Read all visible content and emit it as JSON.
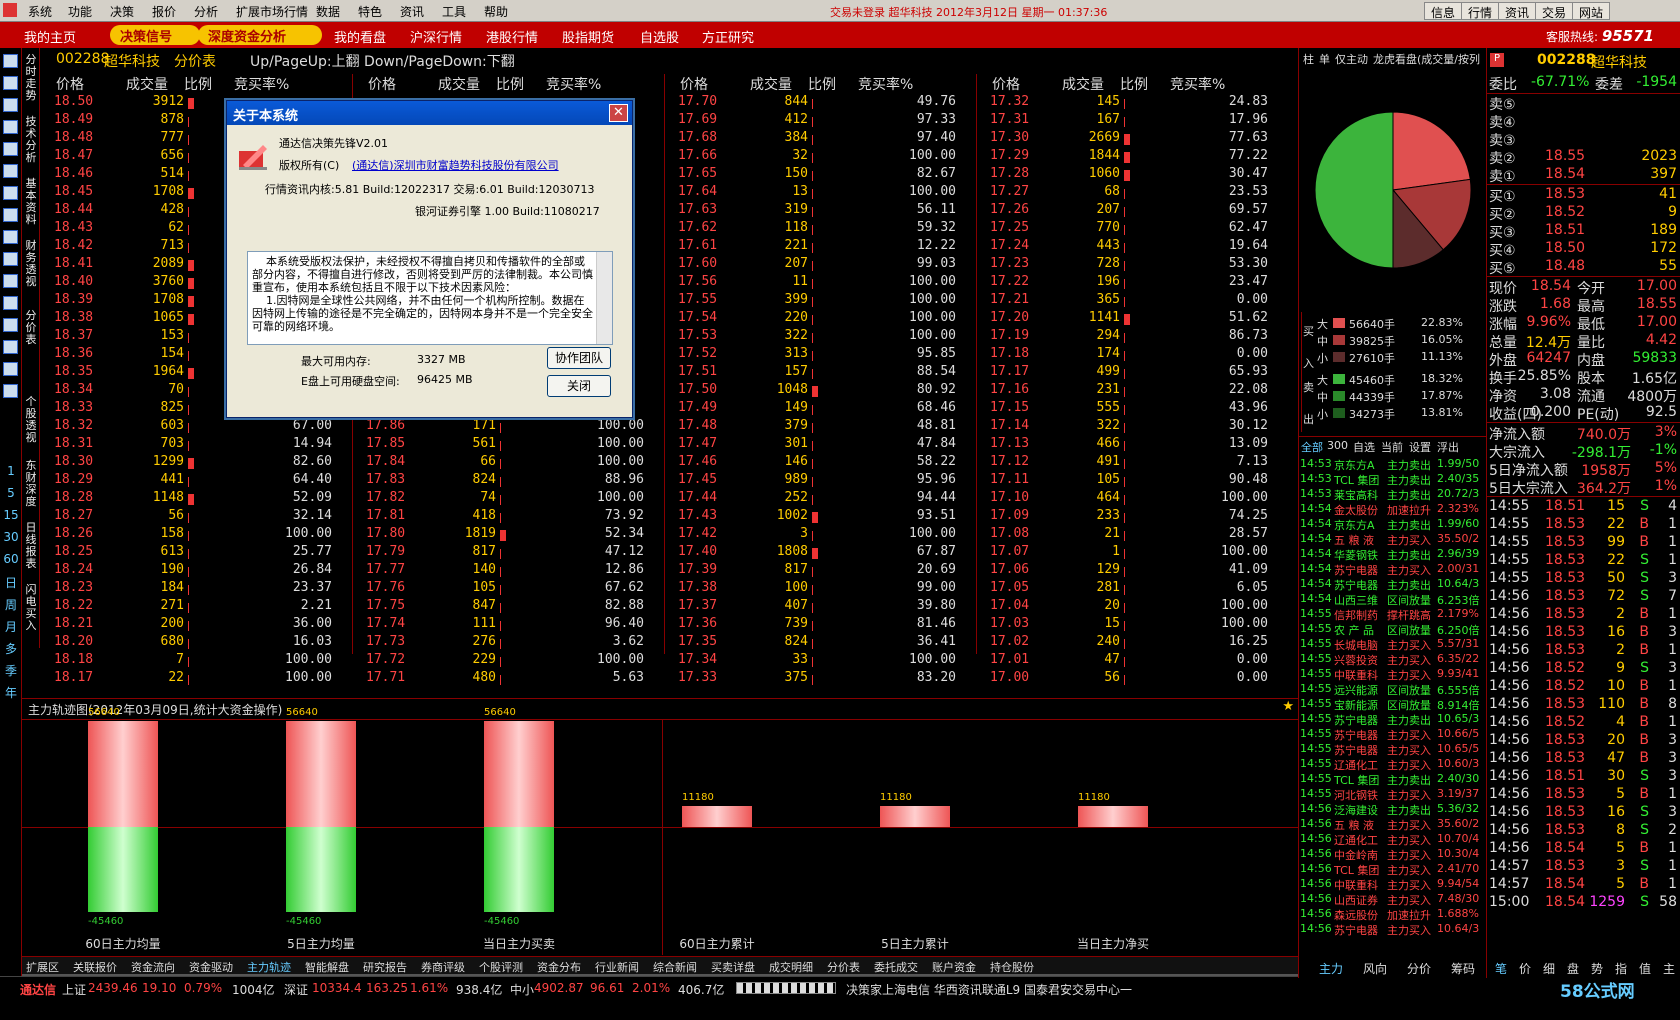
{
  "menu": {
    "items": [
      "系统",
      "功能",
      "决策",
      "报价",
      "分析",
      "扩展市场行情",
      "数据",
      "特色",
      "资讯",
      "工具",
      "帮助"
    ],
    "status": "交易未登录  超华科技  2012年3月12日  星期一  01:37:36",
    "right": [
      "信息",
      "行情",
      "资讯",
      "交易",
      "网站"
    ]
  },
  "nav": {
    "items": [
      "我的主页",
      "决策信号",
      "深度资金分析",
      "我的看盘",
      "沪深行情",
      "港股行情",
      "股指期货",
      "自选股",
      "方正研究"
    ],
    "hotline_label": "客服热线:",
    "hotline_num": "95571"
  },
  "leftbar": {
    "vtext": [
      "分时走势",
      "技术分析",
      "基本资料",
      "财务透视",
      "分价表",
      "个股透视",
      "东财深度",
      "日线报表",
      "闪电买入"
    ],
    "periods": [
      "1",
      "5",
      "15",
      "30",
      "60",
      "日",
      "周",
      "月",
      "多",
      "季",
      "年"
    ]
  },
  "header": {
    "code": "002288",
    "name": "超华科技",
    "view": "分价表",
    "hint": "Up/PageUp:上翻 Down/PageDown:下翻"
  },
  "cols": {
    "price": "价格",
    "volume": "成交量",
    "ratio": "比例",
    "bidrate": "竞买率%"
  },
  "table": {
    "c1": [
      [
        "18.50",
        "3912",
        ""
      ],
      [
        "18.49",
        "878",
        ""
      ],
      [
        "18.48",
        "777",
        ""
      ],
      [
        "18.47",
        "656",
        ""
      ],
      [
        "18.46",
        "514",
        ""
      ],
      [
        "18.45",
        "1708",
        ""
      ],
      [
        "18.44",
        "428",
        ""
      ],
      [
        "18.43",
        "62",
        ""
      ],
      [
        "18.42",
        "713",
        ""
      ],
      [
        "18.41",
        "2089",
        ""
      ],
      [
        "18.40",
        "3760",
        ""
      ],
      [
        "18.39",
        "1708",
        ""
      ],
      [
        "18.38",
        "1065",
        ""
      ],
      [
        "18.37",
        "153",
        ""
      ],
      [
        "18.36",
        "154",
        ""
      ],
      [
        "18.35",
        "1964",
        ""
      ],
      [
        "18.34",
        "70",
        ""
      ],
      [
        "18.33",
        "825",
        ""
      ],
      [
        "18.32",
        "603",
        "67.00"
      ],
      [
        "18.31",
        "703",
        "14.94"
      ],
      [
        "18.30",
        "1299",
        "82.60"
      ],
      [
        "18.29",
        "441",
        "64.40"
      ],
      [
        "18.28",
        "1148",
        "52.09"
      ],
      [
        "18.27",
        "56",
        "32.14"
      ],
      [
        "18.26",
        "158",
        "100.00"
      ],
      [
        "18.25",
        "613",
        "25.77"
      ],
      [
        "18.24",
        "190",
        "26.84"
      ],
      [
        "18.23",
        "184",
        "23.37"
      ],
      [
        "18.22",
        "271",
        "2.21"
      ],
      [
        "18.21",
        "200",
        "36.00"
      ],
      [
        "18.20",
        "680",
        "16.03"
      ],
      [
        "18.18",
        "7",
        "100.00"
      ],
      [
        "18.17",
        "22",
        "100.00"
      ]
    ],
    "c2": [
      [
        "",
        "",
        ""
      ],
      [
        "",
        "",
        ""
      ],
      [
        "",
        "",
        ""
      ],
      [
        "",
        "",
        ""
      ],
      [
        "",
        "",
        ""
      ],
      [
        "",
        "",
        ""
      ],
      [
        "",
        "",
        ""
      ],
      [
        "",
        "",
        ""
      ],
      [
        "",
        "",
        ""
      ],
      [
        "",
        "",
        ""
      ],
      [
        "",
        "",
        ""
      ],
      [
        "",
        "",
        ""
      ],
      [
        "",
        "",
        ""
      ],
      [
        "",
        "",
        ""
      ],
      [
        "",
        "",
        ""
      ],
      [
        "",
        "",
        ""
      ],
      [
        "",
        "",
        ""
      ],
      [
        "",
        "",
        ""
      ],
      [
        "17.86",
        "171",
        "100.00"
      ],
      [
        "17.85",
        "561",
        "100.00"
      ],
      [
        "17.84",
        "66",
        "100.00"
      ],
      [
        "17.83",
        "824",
        "88.96"
      ],
      [
        "17.82",
        "74",
        "100.00"
      ],
      [
        "17.81",
        "418",
        "73.92"
      ],
      [
        "17.80",
        "1819",
        "52.34"
      ],
      [
        "17.79",
        "817",
        "47.12"
      ],
      [
        "17.77",
        "140",
        "12.86"
      ],
      [
        "17.76",
        "105",
        "67.62"
      ],
      [
        "17.75",
        "847",
        "82.88"
      ],
      [
        "17.74",
        "111",
        "96.40"
      ],
      [
        "17.73",
        "276",
        "3.62"
      ],
      [
        "17.72",
        "229",
        "100.00"
      ],
      [
        "17.71",
        "480",
        "5.63"
      ]
    ],
    "c3": [
      [
        "17.70",
        "844",
        "49.76"
      ],
      [
        "17.69",
        "412",
        "97.33"
      ],
      [
        "17.68",
        "384",
        "97.40"
      ],
      [
        "17.66",
        "32",
        "100.00"
      ],
      [
        "17.65",
        "150",
        "82.67"
      ],
      [
        "17.64",
        "13",
        "100.00"
      ],
      [
        "17.63",
        "319",
        "56.11"
      ],
      [
        "17.62",
        "118",
        "59.32"
      ],
      [
        "17.61",
        "221",
        "12.22"
      ],
      [
        "17.60",
        "207",
        "99.03"
      ],
      [
        "17.56",
        "11",
        "100.00"
      ],
      [
        "17.55",
        "399",
        "100.00"
      ],
      [
        "17.54",
        "220",
        "100.00"
      ],
      [
        "17.53",
        "322",
        "100.00"
      ],
      [
        "17.52",
        "313",
        "95.85"
      ],
      [
        "17.51",
        "157",
        "88.54"
      ],
      [
        "17.50",
        "1048",
        "80.92"
      ],
      [
        "17.49",
        "149",
        "68.46"
      ],
      [
        "17.48",
        "379",
        "48.81"
      ],
      [
        "17.47",
        "301",
        "47.84"
      ],
      [
        "17.46",
        "146",
        "58.22"
      ],
      [
        "17.45",
        "989",
        "95.96"
      ],
      [
        "17.44",
        "252",
        "94.44"
      ],
      [
        "17.43",
        "1002",
        "93.51"
      ],
      [
        "17.42",
        "3",
        "100.00"
      ],
      [
        "17.40",
        "1808",
        "67.87"
      ],
      [
        "17.39",
        "817",
        "20.69"
      ],
      [
        "17.38",
        "100",
        "99.00"
      ],
      [
        "17.37",
        "407",
        "39.80"
      ],
      [
        "17.36",
        "739",
        "81.46"
      ],
      [
        "17.35",
        "824",
        "36.41"
      ],
      [
        "17.34",
        "33",
        "100.00"
      ],
      [
        "17.33",
        "375",
        "83.20"
      ]
    ],
    "c4": [
      [
        "17.32",
        "145",
        "24.83"
      ],
      [
        "17.31",
        "167",
        "17.96"
      ],
      [
        "17.30",
        "2669",
        "77.63"
      ],
      [
        "17.29",
        "1844",
        "77.22"
      ],
      [
        "17.28",
        "1060",
        "30.47"
      ],
      [
        "17.27",
        "68",
        "23.53"
      ],
      [
        "17.26",
        "207",
        "69.57"
      ],
      [
        "17.25",
        "770",
        "62.47"
      ],
      [
        "17.24",
        "443",
        "19.64"
      ],
      [
        "17.23",
        "728",
        "53.30"
      ],
      [
        "17.22",
        "196",
        "23.47"
      ],
      [
        "17.21",
        "365",
        "0.00"
      ],
      [
        "17.20",
        "1141",
        "51.62"
      ],
      [
        "17.19",
        "294",
        "86.73"
      ],
      [
        "17.18",
        "174",
        "0.00"
      ],
      [
        "17.17",
        "499",
        "65.93"
      ],
      [
        "17.16",
        "231",
        "22.08"
      ],
      [
        "17.15",
        "555",
        "43.96"
      ],
      [
        "17.14",
        "322",
        "30.12"
      ],
      [
        "17.13",
        "466",
        "13.09"
      ],
      [
        "17.12",
        "491",
        "7.13"
      ],
      [
        "17.11",
        "105",
        "90.48"
      ],
      [
        "17.10",
        "464",
        "100.00"
      ],
      [
        "17.09",
        "233",
        "74.25"
      ],
      [
        "17.08",
        "21",
        "28.57"
      ],
      [
        "17.07",
        "1",
        "100.00"
      ],
      [
        "17.06",
        "129",
        "41.09"
      ],
      [
        "17.05",
        "281",
        "6.05"
      ],
      [
        "17.04",
        "20",
        "100.00"
      ],
      [
        "17.03",
        "15",
        "100.00"
      ],
      [
        "17.02",
        "240",
        "16.25"
      ],
      [
        "17.01",
        "47",
        "0.00"
      ],
      [
        "17.00",
        "56",
        "0.00"
      ]
    ]
  },
  "dialog": {
    "title": "关于本系统",
    "product": "通达信决策先锋V2.01",
    "copyright_label": "版权所有(C)",
    "company": "(通达信)深圳市财富趋势科技股份有限公司",
    "kernel": "行情资讯内核:5.81 Build:12022317  交易:6.01 Build:12030713",
    "engine": "银河证券引擎 1.00 Build:11080217",
    "license": "    本系统受版权法保护，未经授权不得擅自拷贝和传播软件的全部或部分内容，不得擅自进行修改，否则将受到严厉的法律制裁。本公司慎重宣布，使用本系统包括且不限于以下技术因素风险：\n    1.因特网是全球性公共网络，并不由任何一个机构所控制。数据在因特网上传输的途径是不完全确定的，因特网本身并不是一个完全安全可靠的网络环境。",
    "mem_label": "最大可用内存:",
    "mem_val": "3327 MB",
    "disk_label": "E盘上可用硬盘空间:",
    "disk_val": "96425 MB",
    "btn_team": "协作团队",
    "btn_close": "关闭"
  },
  "chart": {
    "title": "主力轨迹图(2012年03月09日,统计大资金操作)",
    "chart_data": {
      "type": "bar",
      "categories": [
        "60日主力均量",
        "5日主力均量",
        "当日主力买卖",
        "60日主力累计",
        "5日主力累计",
        "当日主力净买"
      ],
      "series": [
        {
          "values": [
            56640,
            56640,
            56640,
            11180,
            11180,
            11180
          ]
        },
        {
          "values": [
            -45460,
            -45460,
            -45460,
            null,
            null,
            null
          ]
        }
      ],
      "top_labels": [
        "56640",
        "56640",
        "56640",
        "11180",
        "11180",
        "11180"
      ],
      "bottom_labels": [
        "-45460",
        "-45460",
        "-45460",
        "",
        "",
        ""
      ]
    }
  },
  "bottomtabs": [
    "扩展区",
    "关联报价",
    "资金流向",
    "资金驱动",
    "主力轨迹",
    "智能解盘",
    "研究报告",
    "券商评级",
    "个股评测",
    "资金分布",
    "行业新闻",
    "综合新闻",
    "买卖详盘",
    "成交明细",
    "分价表",
    "委托成交",
    "账户资金",
    "持仓股份"
  ],
  "status": {
    "app": "通达信",
    "sh_label": "上证",
    "sh": "2439.46",
    "sh_chg": "19.10",
    "sh_pct": "0.79%",
    "sh_amt": "1004亿",
    "sz_label": "深证",
    "sz": "10334.4",
    "sz_chg": "163.25",
    "sz_pct": "1.61%",
    "sz_amt": "938.4亿",
    "zx_label": "中小",
    "zx": "4902.87",
    "zx_chg": "96.61",
    "zx_pct": "2.01%",
    "zx_amt": "406.7亿",
    "conn": "决策家上海电信  华西资讯联通L9  国泰君安交易中心一",
    "site": "58公式网"
  },
  "mid": {
    "tabs": [
      "柱",
      "单",
      "仅主动",
      "龙虎看盘(成交量/按列"
    ],
    "pie_colors": [
      "#e04040",
      "#a03030",
      "#603030",
      "#40c040"
    ],
    "buy_label": "买入",
    "sell_label": "卖出",
    "buy": [
      [
        "大",
        "56640手",
        "22.83%"
      ],
      [
        "中",
        "39825手",
        "16.05%"
      ],
      [
        "小",
        "27610手",
        "11.13%"
      ]
    ],
    "sell": [
      [
        "大",
        "45460手",
        "18.32%"
      ],
      [
        "中",
        "44339手",
        "17.87%"
      ],
      [
        "小",
        "34273手",
        "13.81%"
      ]
    ],
    "filters": [
      "全部",
      "300",
      "自选",
      "当前",
      "设置",
      "浮出"
    ],
    "ticks": [
      [
        "14:53",
        "京东方A",
        "主力卖出",
        "1.99/50"
      ],
      [
        "14:53",
        "TCL 集团",
        "主力卖出",
        "2.40/35"
      ],
      [
        "14:53",
        "莱宝高科",
        "主力卖出",
        "20.72/3"
      ],
      [
        "14:54",
        "金太股份",
        "加速拉升",
        "2.323%"
      ],
      [
        "14:54",
        "京东方A",
        "主力卖出",
        "1.99/60"
      ],
      [
        "14:54",
        "五 粮 液",
        "主力买入",
        "35.50/2"
      ],
      [
        "14:54",
        "华菱钢铁",
        "主力卖出",
        "2.96/39"
      ],
      [
        "14:54",
        "苏宁电器",
        "主力买入",
        "2.00/31"
      ],
      [
        "14:54",
        "苏宁电器",
        "主力卖出",
        "10.64/3"
      ],
      [
        "14:54",
        "山西三维",
        "区间放量",
        "6.253倍"
      ],
      [
        "14:55",
        "信邦制药",
        "撑杆跳高",
        "2.179%"
      ],
      [
        "14:55",
        "农 产 品",
        "区间放量",
        "6.250倍"
      ],
      [
        "14:55",
        "长城电脑",
        "主力买入",
        "5.57/31"
      ],
      [
        "14:55",
        "兴蓉投资",
        "主力买入",
        "6.35/22"
      ],
      [
        "14:55",
        "中联重科",
        "主力买入",
        "9.93/41"
      ],
      [
        "14:55",
        "远兴能源",
        "区间放量",
        "6.555倍"
      ],
      [
        "14:55",
        "宝新能源",
        "区间放量",
        "8.914倍"
      ],
      [
        "14:55",
        "苏宁电器",
        "主力卖出",
        "10.65/3"
      ],
      [
        "14:55",
        "苏宁电器",
        "主力买入",
        "10.66/5"
      ],
      [
        "14:55",
        "苏宁电器",
        "主力买入",
        "10.65/5"
      ],
      [
        "14:55",
        "辽通化工",
        "主力买入",
        "10.60/3"
      ],
      [
        "14:55",
        "TCL 集团",
        "主力卖出",
        "2.40/30"
      ],
      [
        "14:55",
        "河北钢铁",
        "主力买入",
        "3.19/37"
      ],
      [
        "14:56",
        "泛海建设",
        "主力卖出",
        "5.36/32"
      ],
      [
        "14:56",
        "五 粮 液",
        "主力买入",
        "35.60/2"
      ],
      [
        "14:56",
        "辽通化工",
        "主力买入",
        "10.70/4"
      ],
      [
        "14:56",
        "中金岭南",
        "主力买入",
        "10.30/4"
      ],
      [
        "14:56",
        "TCL 集团",
        "主力买入",
        "2.41/70"
      ],
      [
        "14:56",
        "中联重科",
        "主力买入",
        "9.94/54"
      ],
      [
        "14:56",
        "山西证券",
        "主力买入",
        "7.48/30"
      ],
      [
        "14:56",
        "森远股份",
        "加速拉升",
        "1.688%"
      ],
      [
        "14:56",
        "苏宁电器",
        "主力买入",
        "10.64/3"
      ]
    ],
    "bottom": [
      "主力",
      "风向",
      "分价",
      "筹码"
    ]
  },
  "right": {
    "code": "002288",
    "name": "超华科技",
    "wb_label": "委比",
    "wb": "-67.71%",
    "wc_label": "委差",
    "wc": "-1954",
    "sells": [
      [
        "卖⑤",
        "",
        ""
      ],
      [
        "卖④",
        "",
        ""
      ],
      [
        "卖③",
        "",
        ""
      ],
      [
        "卖②",
        "18.55",
        "2023"
      ],
      [
        "卖①",
        "18.54",
        "397"
      ]
    ],
    "buys": [
      [
        "买①",
        "18.53",
        "41"
      ],
      [
        "买②",
        "18.52",
        "9"
      ],
      [
        "买③",
        "18.51",
        "189"
      ],
      [
        "买④",
        "18.50",
        "172"
      ],
      [
        "买⑤",
        "18.48",
        "55"
      ]
    ],
    "stats": [
      [
        "现价",
        "18.54",
        "今开",
        "17.00"
      ],
      [
        "涨跌",
        "1.68",
        "最高",
        "18.55"
      ],
      [
        "涨幅",
        "9.96%",
        "最低",
        "17.00"
      ],
      [
        "总量",
        "12.4万",
        "量比",
        "4.42"
      ],
      [
        "外盘",
        "64247",
        "内盘",
        "59833"
      ],
      [
        "换手",
        "25.85%",
        "股本",
        "1.65亿"
      ],
      [
        "净资",
        "3.08",
        "流通",
        "4800万"
      ],
      [
        "收益(四)",
        "0.200",
        "PE(动)",
        "92.5"
      ]
    ],
    "flows": [
      [
        "净流入额",
        "740.0万",
        "3%"
      ],
      [
        "大宗流入",
        "-298.1万",
        "-1%"
      ],
      [
        "5日净流入额",
        "1958万",
        "5%"
      ],
      [
        "5日大宗流入",
        "364.2万",
        "1%"
      ]
    ],
    "ticks": [
      [
        "14:55",
        "18.51",
        "15",
        "S",
        "4"
      ],
      [
        "14:55",
        "18.53",
        "22",
        "B",
        "1"
      ],
      [
        "14:55",
        "18.53",
        "99",
        "B",
        "1"
      ],
      [
        "14:55",
        "18.53",
        "22",
        "S",
        "1"
      ],
      [
        "14:55",
        "18.53",
        "50",
        "S",
        "3"
      ],
      [
        "14:56",
        "18.53",
        "72",
        "S",
        "7"
      ],
      [
        "14:56",
        "18.53",
        "2",
        "B",
        "1"
      ],
      [
        "14:56",
        "18.53",
        "16",
        "B",
        "3"
      ],
      [
        "14:56",
        "18.53",
        "2",
        "B",
        "1"
      ],
      [
        "14:56",
        "18.52",
        "9",
        "S",
        "3"
      ],
      [
        "14:56",
        "18.52",
        "10",
        "B",
        "1"
      ],
      [
        "14:56",
        "18.53",
        "110",
        "B",
        "8"
      ],
      [
        "14:56",
        "18.52",
        "4",
        "B",
        "1"
      ],
      [
        "14:56",
        "18.53",
        "20",
        "B",
        "3"
      ],
      [
        "14:56",
        "18.53",
        "47",
        "B",
        "3"
      ],
      [
        "14:56",
        "18.51",
        "30",
        "S",
        "3"
      ],
      [
        "14:56",
        "18.53",
        "5",
        "B",
        "1"
      ],
      [
        "14:56",
        "18.53",
        "16",
        "S",
        "3"
      ],
      [
        "14:56",
        "18.53",
        "8",
        "S",
        "2"
      ],
      [
        "14:56",
        "18.54",
        "5",
        "B",
        "1"
      ],
      [
        "14:57",
        "18.53",
        "3",
        "S",
        "1"
      ],
      [
        "14:57",
        "18.54",
        "5",
        "B",
        "1"
      ],
      [
        "15:00",
        "18.54",
        "1259",
        "S",
        "58"
      ]
    ],
    "bottom": [
      "笔",
      "价",
      "细",
      "盘",
      "势",
      "指",
      "值",
      "主"
    ]
  }
}
